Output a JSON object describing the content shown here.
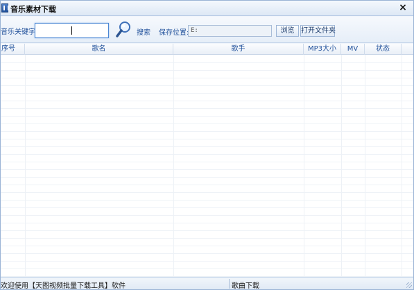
{
  "window": {
    "title": "音乐素材下载",
    "close_glyph": "×"
  },
  "toolbar": {
    "keyword_label": "音乐关键字:",
    "keyword_value": "",
    "search_label": "搜索",
    "save_location_label": "保存位置:",
    "save_path_value": "E:",
    "browse_label": "浏览",
    "open_folder_label": "打开文件夹",
    "search_icon": "magnifier-icon"
  },
  "table": {
    "columns": [
      "序号",
      "歌名",
      "歌手",
      "MP3大小",
      "MV",
      "状态"
    ],
    "rows": []
  },
  "status": {
    "left_text": "欢迎使用【天图视频批量下载工具】软件",
    "right_text": "歌曲下载"
  },
  "colors": {
    "accent": "#1f4f9a",
    "input_border": "#4a86d4",
    "window_bg": "#eef3fa"
  }
}
